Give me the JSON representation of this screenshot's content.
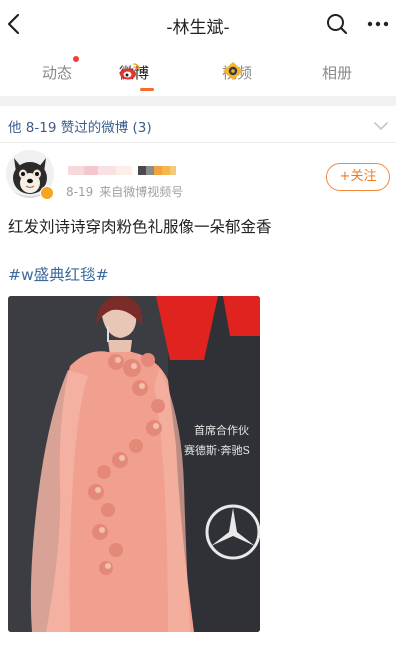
{
  "header": {
    "title": "-林生斌-",
    "back_icon": "back-arrow-icon",
    "search_icon": "search-icon",
    "more_icon": "more-icon"
  },
  "tabs": [
    {
      "label": "动态",
      "has_dot": true
    },
    {
      "label": "微博",
      "icon": "weibo-logo-icon",
      "active": true
    },
    {
      "label": "视频",
      "icon": "video-icon"
    },
    {
      "label": "相册"
    }
  ],
  "section": {
    "title": "他 8-19 赞过的微博 (3)",
    "collapse_icon": "chevron-down-icon"
  },
  "post": {
    "date": "8-19",
    "source": "来自微博视频号",
    "follow_label": "+关注",
    "text": "红发刘诗诗穿肉粉色礼服像一朵郁金香",
    "hashtag": "#w盛典红毯#",
    "video_caption_1": "首席合作伙",
    "video_caption_2": "赛德斯·奔驰S"
  },
  "colors": {
    "accent": "#f56c2d",
    "link": "#3d6b9e",
    "follow": "#f07a20",
    "dot": "#f23c3c"
  }
}
